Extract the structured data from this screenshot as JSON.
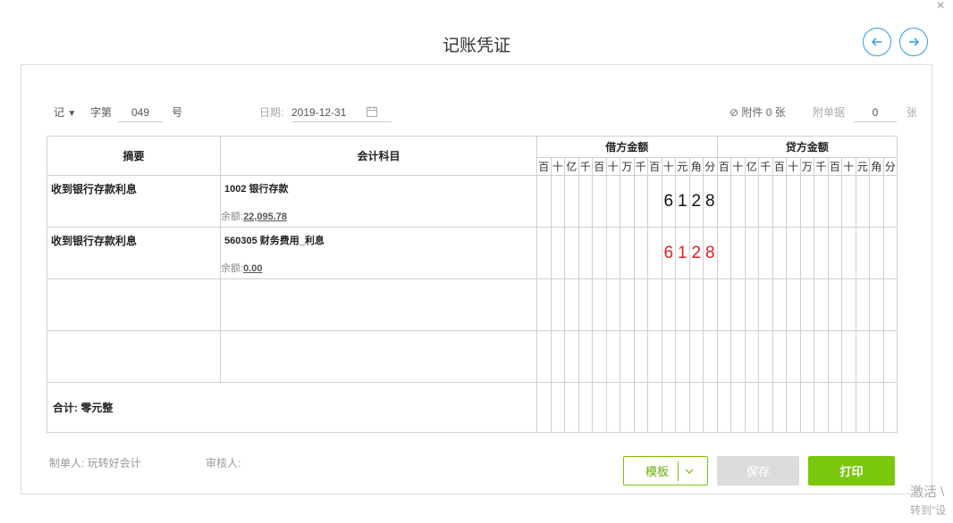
{
  "header": {
    "title": "记账凭证"
  },
  "meta": {
    "word_type": "记",
    "word_label": "字第",
    "voucher_no": "049",
    "no_suffix": "号",
    "date_label": "日期:",
    "date_value": "2019-12-31",
    "attachment_label": "附件 0 张",
    "attach_doc_label": "附单据",
    "attach_doc_count": "0",
    "attach_doc_unit": "张"
  },
  "table": {
    "col_summary": "摘要",
    "col_account": "会计科目",
    "col_debit": "借方金额",
    "col_credit": "贷方金额",
    "digit_units": [
      "百",
      "十",
      "亿",
      "千",
      "百",
      "十",
      "万",
      "千",
      "百",
      "十",
      "元",
      "角",
      "分"
    ],
    "rows": [
      {
        "summary": "收到银行存款利息",
        "account": "1002 银行存款",
        "balance_label": "余额:",
        "balance": "22,095.78",
        "debit": "6128",
        "credit": ""
      },
      {
        "summary": "收到银行存款利息",
        "account": "560305 财务费用_利息",
        "balance_label": "余额:",
        "balance": "0.00",
        "debit": "6128",
        "credit": ""
      },
      {
        "summary": "",
        "account": "",
        "debit": "",
        "credit": ""
      },
      {
        "summary": "",
        "account": "",
        "debit": "",
        "credit": ""
      }
    ],
    "total_label": "合计:  零元整"
  },
  "footer": {
    "maker": "制单人: 玩转好会计",
    "reviewer": "审核人:",
    "template_btn": "模板",
    "save_btn": "保存",
    "print_btn": "打印"
  },
  "watermark": {
    "line1": "激活 \\",
    "line2": "转到\"设"
  },
  "colors": {
    "accent": "#7ac70c",
    "nav": "#2e9fe8",
    "negative": "#e02020"
  },
  "icons": [
    "close-icon",
    "arrow-left-icon",
    "arrow-right-icon",
    "caret-down-icon",
    "calendar-icon",
    "paperclip-icon",
    "chevron-down-icon"
  ]
}
